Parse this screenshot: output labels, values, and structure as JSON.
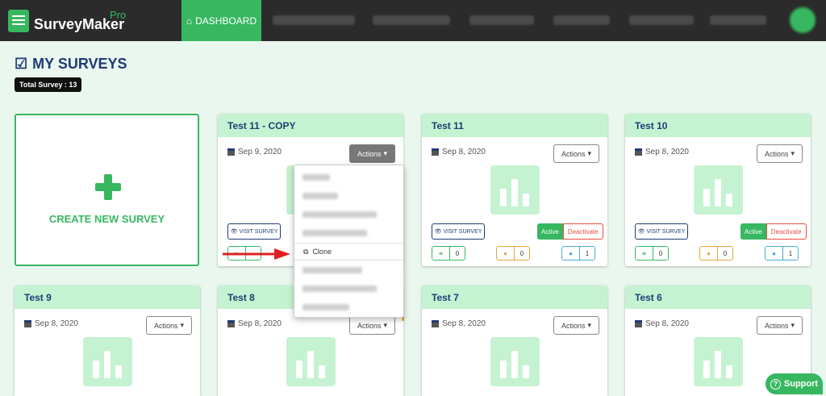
{
  "brand": {
    "name": "SurveyMaker",
    "sup": "Pro"
  },
  "nav": {
    "active": "DASHBOARD"
  },
  "page": {
    "title": "MY SURVEYS",
    "total_badge": "Total Survey : 13"
  },
  "create": {
    "label": "CREATE NEW SURVEY"
  },
  "actions_label": "Actions",
  "visit_label": "VISIT SURVEY",
  "status": {
    "active": "Active",
    "deactivate": "Deactivate"
  },
  "menu": {
    "clone": "Clone"
  },
  "support": "Support",
  "colors": {
    "accent": "#37b760",
    "header_bg": "#2b2b2b",
    "title": "#1f3b73",
    "card_head": "#c5f3d1",
    "deactivate": "#e74c3c"
  },
  "cards": [
    {
      "title": "Test 11 - COPY",
      "date": "Sep 9, 2020"
    },
    {
      "title": "Test 11",
      "date": "Sep 8, 2020",
      "stats": [
        "0",
        "0",
        "1"
      ]
    },
    {
      "title": "Test 10",
      "date": "Sep 8, 2020",
      "stats": [
        "0",
        "0",
        "1"
      ]
    },
    {
      "title": "Test 9",
      "date": "Sep 8, 2020"
    },
    {
      "title": "Test 8",
      "date": "Sep 8, 2020"
    },
    {
      "title": "Test 7",
      "date": "Sep 8, 2020"
    },
    {
      "title": "Test 6",
      "date": "Sep 8, 2020"
    }
  ]
}
